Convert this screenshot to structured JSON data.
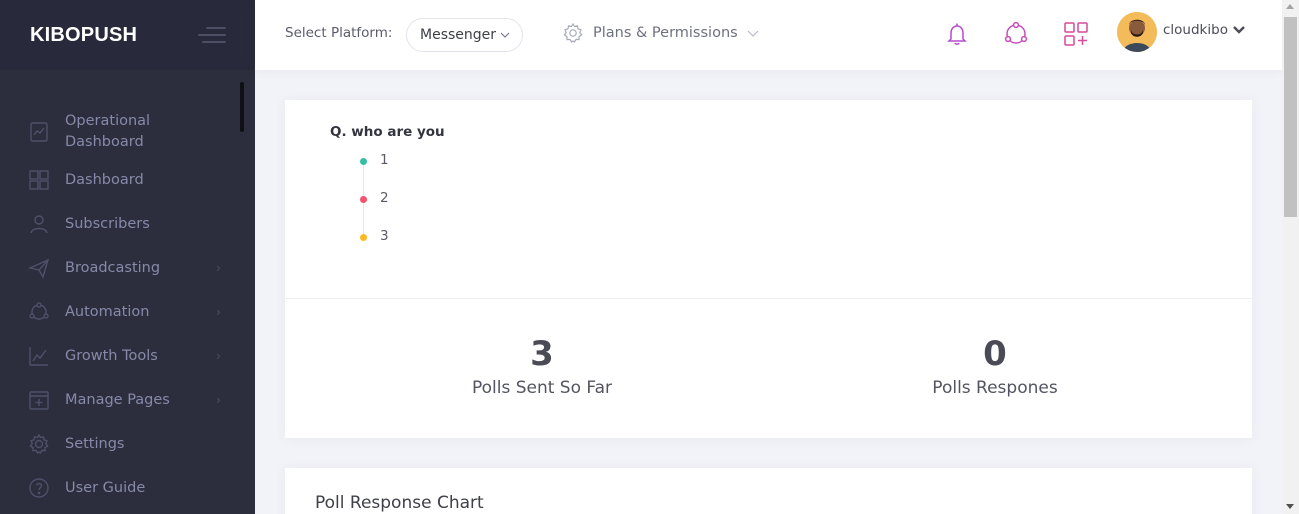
{
  "brand": {
    "name": "KIBOPUSH"
  },
  "sidebar": {
    "items": [
      {
        "label": "Operational Dashboard",
        "icon": "chart-board-icon",
        "has_arrow": false
      },
      {
        "label": "Dashboard",
        "icon": "grid-icon",
        "has_arrow": false
      },
      {
        "label": "Subscribers",
        "icon": "user-icon",
        "has_arrow": false
      },
      {
        "label": "Broadcasting",
        "icon": "paper-plane-icon",
        "has_arrow": true
      },
      {
        "label": "Automation",
        "icon": "network-icon",
        "has_arrow": true
      },
      {
        "label": "Growth Tools",
        "icon": "line-chart-icon",
        "has_arrow": true
      },
      {
        "label": "Manage Pages",
        "icon": "add-page-icon",
        "has_arrow": true
      },
      {
        "label": "Settings",
        "icon": "gear-icon",
        "has_arrow": false
      },
      {
        "label": "User Guide",
        "icon": "question-icon",
        "has_arrow": false
      }
    ],
    "arrow_glyph": "›"
  },
  "header": {
    "select_platform_label": "Select Platform:",
    "platform_value": "Messenger",
    "plans_label": "Plans & Permissions",
    "user_name": "cloudkibo",
    "icons": [
      "bell-icon",
      "network-icon",
      "apps-add-icon"
    ]
  },
  "poll": {
    "question": "Q. who are you",
    "options": [
      {
        "label": "1",
        "color": "#34bfa3"
      },
      {
        "label": "2",
        "color": "#f4516c"
      },
      {
        "label": "3",
        "color": "#ffb822"
      }
    ]
  },
  "stats": {
    "sent": {
      "value": "3",
      "label": "Polls Sent So Far"
    },
    "responses": {
      "value": "0",
      "label": "Polls Respones"
    }
  },
  "chart_card": {
    "title": "Poll Response Chart"
  },
  "colors": {
    "sidebar_bg": "#2c2e3e",
    "accent_purple": "#b54bd1",
    "accent_pink": "#d9489a"
  }
}
